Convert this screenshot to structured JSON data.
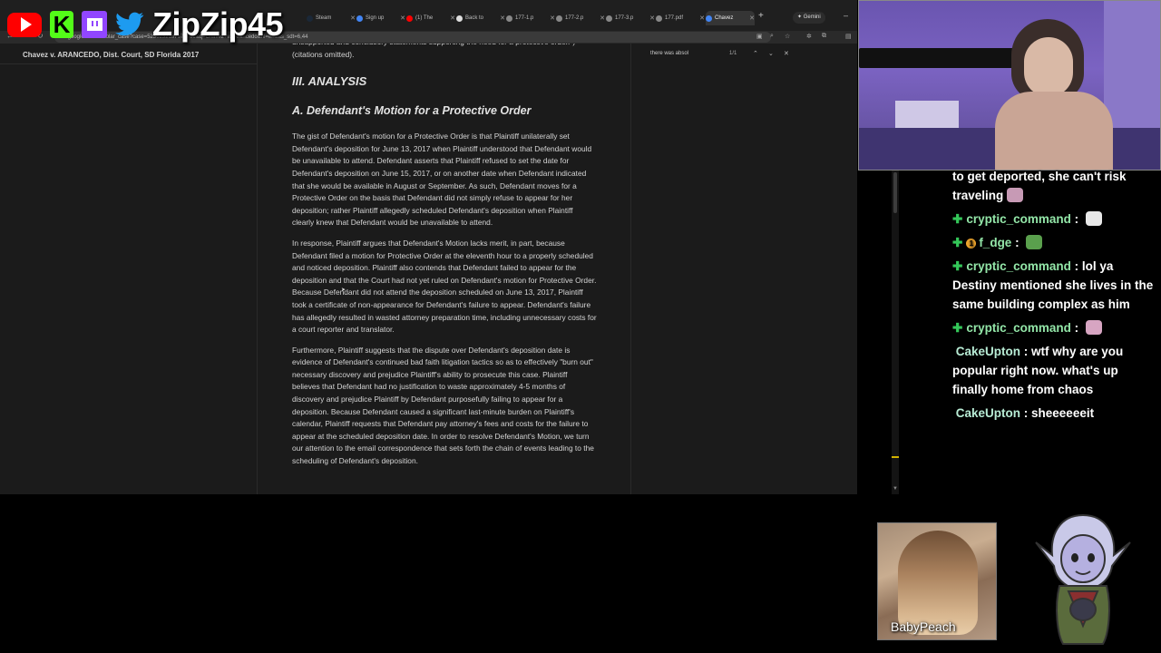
{
  "browser": {
    "tabs": [
      {
        "label": "Steam",
        "color": "#1b2838"
      },
      {
        "label": "Sign up",
        "color": "#4285f4"
      },
      {
        "label": "(1) The",
        "color": "#ff0000"
      },
      {
        "label": "Back to",
        "color": "#ffffff"
      },
      {
        "label": "177-1.p",
        "color": "#888888"
      },
      {
        "label": "177-2.p",
        "color": "#888888"
      },
      {
        "label": "177-3.p",
        "color": "#888888"
      },
      {
        "label": "177.pdf",
        "color": "#888888"
      },
      {
        "label": "Chavez",
        "color": "#4285f4"
      }
    ],
    "new_tab": "+",
    "gemini_label": "Gemini",
    "url": "ar.google.com/scholar_case?case=5236232187673761&q=Chavez+v.+Arancedo&hl=en&as_sdt=6,44"
  },
  "find": {
    "query": "there was absol",
    "count": "1/1"
  },
  "case_title": "Chavez v. ARANCEDO, Dist. Court, SD Florida 2017",
  "document": {
    "intro": "unsupported and conclusory statements supporting the need for a protective order.\") (citations omitted).",
    "section_heading": "III. ANALYSIS",
    "sub_heading": "A. Defendant's Motion for a Protective Order",
    "paragraphs": [
      "The gist of Defendant's motion for a Protective Order is that Plaintiff unilaterally set Defendant's deposition for June 13, 2017 when Plaintiff understood that Defendant would be unavailable to attend. Defendant asserts that Plaintiff refused to set the date for Defendant's deposition on June 15, 2017, or on another date when Defendant indicated that she would be available in August or September. As such, Defendant moves for a Protective Order on the basis that Defendant did not simply refuse to appear for her deposition; rather Plaintiff allegedly scheduled Defendant's deposition when Plaintiff clearly knew that Defendant would be unavailable to attend.",
      "In response, Plaintiff argues that Defendant's Motion lacks merit, in part, because Defendant filed a motion for Protective Order at the eleventh hour to a properly scheduled and noticed deposition. Plaintiff also contends that Defendant failed to appear for the deposition and that the Court had not yet ruled on Defendant's motion for Protective Order. Because Defendant did not attend the deposition scheduled on June 13, 2017, Plaintiff took a certificate of non-appearance for Defendant's failure to appear. Defendant's failure has allegedly resulted in wasted attorney preparation time, including unnecessary costs for a court reporter and translator.",
      "Furthermore, Plaintiff suggests that the dispute over Defendant's deposition date is evidence of Defendant's continued bad faith litigation tactics so as to effectively \"burn out\" necessary discovery and prejudice Plaintiff's ability to prosecute this case. Plaintiff believes that Defendant had no justification to waste approximately 4-5 months of discovery and prejudice Plaintiff by Defendant purposefully failing to appear for a deposition. Because Defendant caused a significant last-minute burden on Plaintiff's calendar, Plaintiff requests that Defendant pay attorney's fees and costs for the failure to appear at the scheduled deposition date. In order to resolve Defendant's Motion, we turn our attention to the email correspondence that sets forth the chain of events leading to the scheduling of Defendant's deposition."
    ]
  },
  "overlay": {
    "handle": "ZipZip45",
    "social_icons": [
      "youtube-icon",
      "kick-icon",
      "twitch-icon",
      "twitter-icon"
    ]
  },
  "chat": [
    {
      "user": "",
      "text": "to get deported, she can't risk traveling",
      "emote": "#c79ab5"
    },
    {
      "user": "cryptic_command",
      "text": "",
      "emote": "#e8e8e8"
    },
    {
      "user": "f_dge",
      "text": "",
      "emote": "#5aa04d",
      "badge": "1"
    },
    {
      "user": "cryptic_command",
      "text": "lol ya Destiny mentioned she lives in the same building complex as him"
    },
    {
      "user": "cryptic_command",
      "text": "",
      "emote": "#d7a5c2"
    },
    {
      "user": "CakeUpton",
      "text": "wtf why are you popular right now. what's up finally home from chaos"
    },
    {
      "user": "CakeUpton",
      "text": "sheeeeeeit"
    }
  ],
  "panels": {
    "baby_peach_label": "BabyPeach"
  },
  "colors": {
    "chat_user": "#93e6a8",
    "scroll_marker": "#d3b300",
    "page_bg": "#1b1b1b"
  }
}
